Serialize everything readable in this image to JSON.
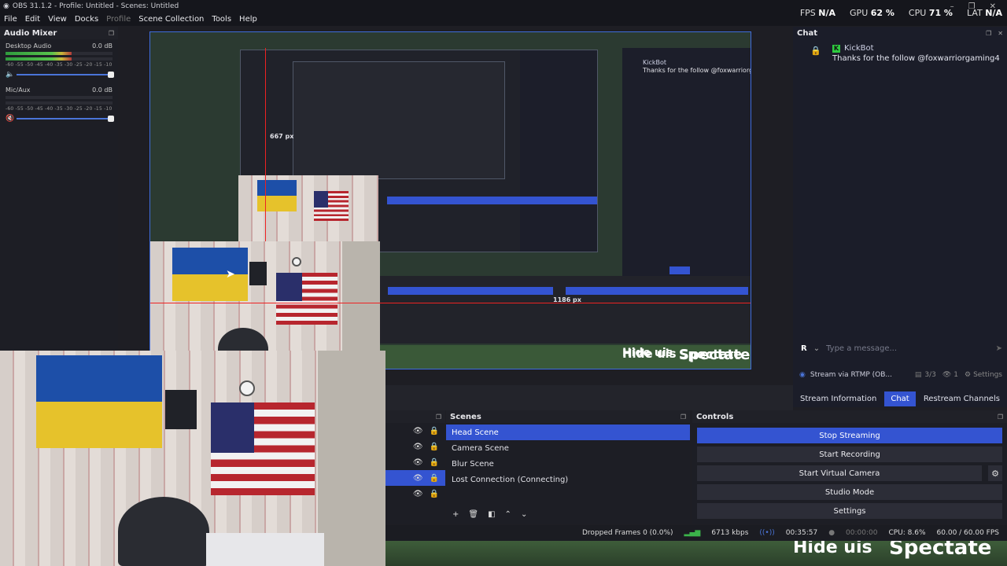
{
  "window": {
    "title": "OBS 31.1.2 - Profile: Untitled - Scenes: Untitled"
  },
  "menu": [
    "File",
    "Edit",
    "View",
    "Docks",
    "Profile",
    "Scene Collection",
    "Tools",
    "Help"
  ],
  "stats": {
    "fps_label": "FPS",
    "fps_value": "N/A",
    "gpu_label": "GPU",
    "gpu_value": "62 %",
    "cpu_label": "CPU",
    "cpu_value": "71 %",
    "lat_label": "LAT",
    "lat_value": "N/A"
  },
  "audio_mixer": {
    "title": "Audio Mixer",
    "tracks": [
      {
        "name": "Desktop Audio",
        "level": "0.0 dB",
        "meter_fill": 0.62,
        "muted": false
      },
      {
        "name": "Mic/Aux",
        "level": "0.0 dB",
        "meter_fill": 0.0,
        "muted": true
      }
    ],
    "scale": "-60 -55 -50 -45 -40 -35 -30 -25 -20 -15 -10 -5 0"
  },
  "preview": {
    "measure_vertical": "667 px",
    "measure_horizontal": "1186 px",
    "overlay_hide": "Hide uis",
    "overlay_spectate": "Spectate"
  },
  "chat": {
    "title": "Chat",
    "message": {
      "user": "KickBot",
      "text": "Thanks for the follow @foxwarriorgaming4"
    },
    "input_placeholder": "Type a message...",
    "input_avatar": "R",
    "status_text": "Stream via RTMP (OB...",
    "status_count": "3/3",
    "status_viewers": "1",
    "settings_label": "Settings",
    "tabs": [
      "Stream Information",
      "Chat",
      "Restream Channels"
    ],
    "active_tab": "Chat"
  },
  "scenes": {
    "title": "Scenes",
    "items": [
      "Head Scene",
      "Camera Scene",
      "Blur Scene",
      "Lost Connection (Connecting)"
    ],
    "active": "Head Scene"
  },
  "controls": {
    "title": "Controls",
    "buttons": [
      "Stop Streaming",
      "Start Recording",
      "Start Virtual Camera",
      "Studio Mode",
      "Settings"
    ]
  },
  "statusbar": {
    "dropped": "Dropped Frames 0 (0.0%)",
    "kbps": "6713 kbps",
    "stream_time": "00:35:57",
    "rec_time": "00:00:00",
    "cpu": "CPU: 8.6%",
    "fps": "60.00 / 60.00 FPS"
  },
  "colors": {
    "accent": "#3454d1",
    "preview_border": "#3f6cdc",
    "meter_green": "#58c34c",
    "red_guide": "#e22222"
  }
}
